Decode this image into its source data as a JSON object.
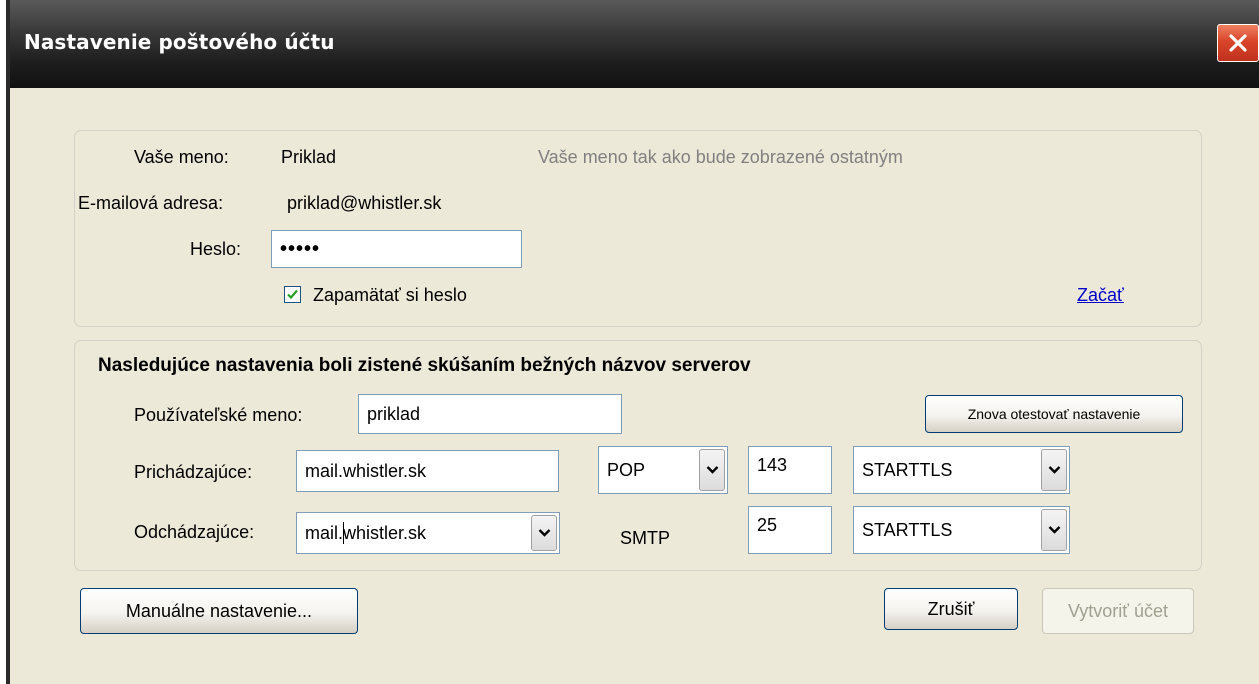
{
  "window": {
    "title": "Nastavenie poštového účtu"
  },
  "account": {
    "name_label": "Vaše meno:",
    "name_value": "Priklad",
    "name_hint": "Vaše meno tak ako bude zobrazené ostatným",
    "email_label": "E-mailová adresa:",
    "email_value": "priklad@whistler.sk",
    "password_label": "Heslo:",
    "password_value": "•••••",
    "remember_label": "Zapamätať si heslo",
    "remember_checked": true,
    "start_link": "Začať"
  },
  "servers": {
    "heading": "Nasledujúce nastavenia boli zistené skúšaním bežných názvov serverov",
    "username_label": "Používateľské meno:",
    "username_value": "priklad",
    "retest_button": "Znova otestovať nastavenie",
    "incoming": {
      "label": "Prichádzajúce:",
      "host": "mail.whistler.sk",
      "protocol": "POP",
      "port": "143",
      "security": "STARTTLS"
    },
    "outgoing": {
      "label": "Odchádzajúce:",
      "host": "mail.whistler.sk",
      "protocol": "SMTP",
      "port": "25",
      "security": "STARTTLS"
    }
  },
  "footer": {
    "manual_button": "Manuálne nastavenie...",
    "cancel_button": "Zrušiť",
    "create_button": "Vytvoriť účet",
    "create_enabled": false
  },
  "icons": {
    "close": "close-icon",
    "check": "check-icon",
    "dropdown": "chevron-down-icon"
  }
}
